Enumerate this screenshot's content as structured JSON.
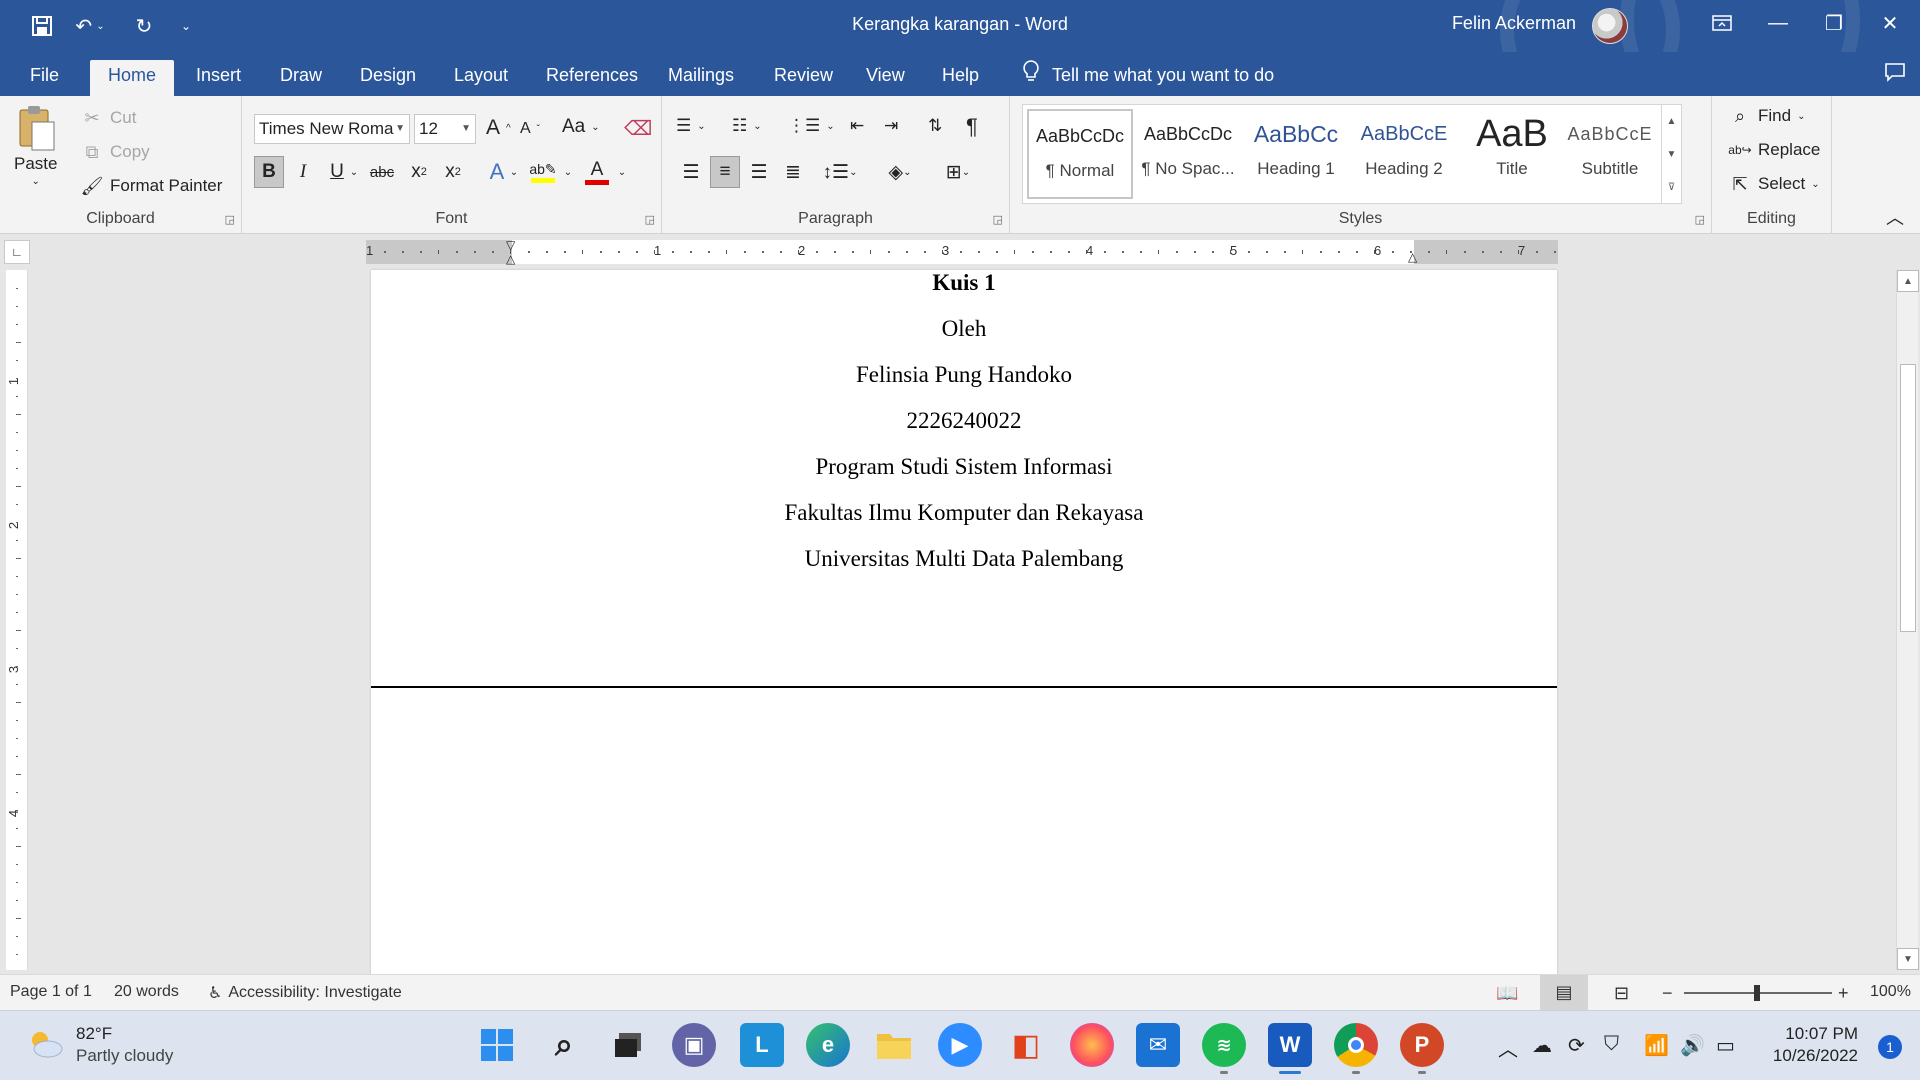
{
  "window": {
    "title": "Kerangka karangan  -  Word",
    "user": "Felin Ackerman",
    "quick_access": [
      "save-icon",
      "undo-icon",
      "redo-icon",
      "customize-icon"
    ]
  },
  "tabs": [
    "File",
    "Home",
    "Insert",
    "Draw",
    "Design",
    "Layout",
    "References",
    "Mailings",
    "Review",
    "View",
    "Help"
  ],
  "active_tab": "Home",
  "tell_me": "Tell me what you want to do",
  "ribbon": {
    "clipboard": {
      "label": "Clipboard",
      "paste": "Paste",
      "cut": "Cut",
      "copy": "Copy",
      "format_painter": "Format Painter"
    },
    "font": {
      "label": "Font",
      "font_name": "Times New Roma",
      "font_size": "12",
      "change_case": "Aa"
    },
    "paragraph": {
      "label": "Paragraph"
    },
    "styles": {
      "label": "Styles",
      "items": [
        {
          "preview": "AaBbCcDc",
          "name": "¶ Normal"
        },
        {
          "preview": "AaBbCcDc",
          "name": "¶ No Spac..."
        },
        {
          "preview": "AaBbCc",
          "name": "Heading 1"
        },
        {
          "preview": "AaBbCcE",
          "name": "Heading 2"
        },
        {
          "preview": "AaB",
          "name": "Title"
        },
        {
          "preview": "AaBbCcE",
          "name": "Subtitle"
        }
      ]
    },
    "editing": {
      "label": "Editing",
      "find": "Find",
      "replace": "Replace",
      "select": "Select"
    }
  },
  "ruler": {
    "numbers": [
      "1",
      "1",
      "2",
      "3",
      "4",
      "5",
      "6",
      "7"
    ],
    "vnumbers": [
      "1",
      "2",
      "3",
      "4"
    ]
  },
  "document": {
    "lines": [
      "Kuis 1",
      "Oleh",
      "Felinsia Pung Handoko",
      "2226240022",
      "Program Studi Sistem Informasi",
      "Fakultas Ilmu Komputer dan Rekayasa",
      "Universitas Multi Data Palembang"
    ]
  },
  "status": {
    "page": "Page 1 of 1",
    "words": "20 words",
    "accessibility": "Accessibility: Investigate",
    "zoom": "100%"
  },
  "taskbar": {
    "weather_temp": "82°F",
    "weather_desc": "Partly cloudy",
    "time": "10:07 PM",
    "date": "10/26/2022",
    "notifications": "1"
  },
  "colors": {
    "word_blue": "#2b579a",
    "page": "#ffffff",
    "canvas": "#e6e6e6"
  }
}
